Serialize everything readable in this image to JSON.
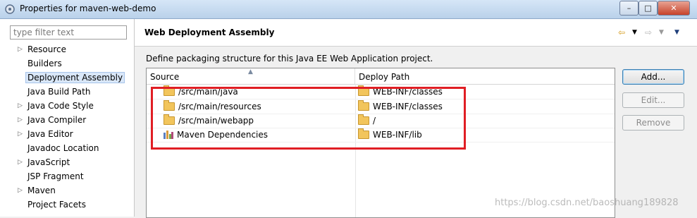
{
  "window": {
    "title": "Properties for maven-web-demo",
    "controls": {
      "minimize": "–",
      "maximize": "□",
      "close": "✕"
    }
  },
  "sidebar": {
    "filter_placeholder": "type filter text",
    "items": [
      {
        "label": "Resource",
        "expandable": true
      },
      {
        "label": "Builders",
        "expandable": false
      },
      {
        "label": "Deployment Assembly",
        "expandable": false,
        "selected": true
      },
      {
        "label": "Java Build Path",
        "expandable": false
      },
      {
        "label": "Java Code Style",
        "expandable": true
      },
      {
        "label": "Java Compiler",
        "expandable": true
      },
      {
        "label": "Java Editor",
        "expandable": true
      },
      {
        "label": "Javadoc Location",
        "expandable": false
      },
      {
        "label": "JavaScript",
        "expandable": true
      },
      {
        "label": "JSP Fragment",
        "expandable": false
      },
      {
        "label": "Maven",
        "expandable": true
      },
      {
        "label": "Project Facets",
        "expandable": false
      }
    ]
  },
  "page": {
    "title": "Web Deployment Assembly",
    "description": "Define packaging structure for this Java EE Web Application project.",
    "nav_icons": [
      "back-arrow-icon",
      "dropdown-icon",
      "forward-arrow-icon",
      "dropdown-icon",
      "menu-icon"
    ]
  },
  "table": {
    "columns": [
      "Source",
      "Deploy Path"
    ],
    "rows": [
      {
        "source": "/src/main/java",
        "deploy": "WEB-INF/classes",
        "icon": "folder-icon"
      },
      {
        "source": "/src/main/resources",
        "deploy": "WEB-INF/classes",
        "icon": "folder-icon"
      },
      {
        "source": "/src/main/webapp",
        "deploy": "/",
        "icon": "folder-icon"
      },
      {
        "source": "Maven Dependencies",
        "deploy": "WEB-INF/lib",
        "icon": "library-icon"
      }
    ]
  },
  "buttons": {
    "add": "Add...",
    "edit": "Edit...",
    "remove": "Remove"
  },
  "watermark": "https://blog.csdn.net/baoshuang189828",
  "colors": {
    "highlight": "#e01e24",
    "selection": "#d9e7f8"
  }
}
